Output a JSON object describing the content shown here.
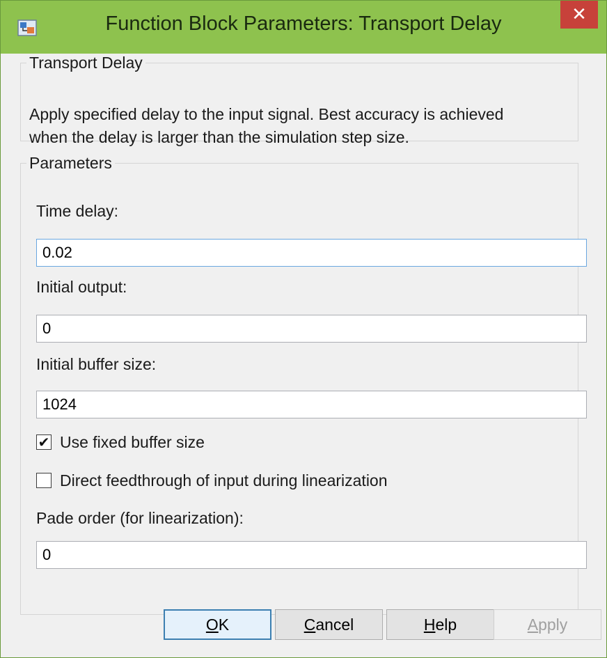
{
  "window": {
    "title": "Function Block Parameters: Transport Delay",
    "close_glyph": "✕"
  },
  "description_group": {
    "legend": "Transport Delay",
    "text_line1": "Apply specified delay to the input signal.  Best accuracy is achieved",
    "text_line2": "when the delay is larger than the simulation step size."
  },
  "parameters_group": {
    "legend": "Parameters",
    "time_delay": {
      "label": "Time delay:",
      "value": "0.02"
    },
    "initial_output": {
      "label": "Initial output:",
      "value": "0"
    },
    "initial_buffer_size": {
      "label": "Initial buffer size:",
      "value": "1024"
    },
    "use_fixed_buffer": {
      "label": "Use fixed buffer size",
      "checked": true,
      "mark": "✔"
    },
    "direct_feedthrough": {
      "label": "Direct feedthrough of input during linearization",
      "checked": false,
      "mark": ""
    },
    "pade_order": {
      "label": "Pade order (for linearization):",
      "value": "0"
    }
  },
  "buttons": {
    "ok": {
      "mnemonic": "O",
      "rest": "K"
    },
    "cancel": {
      "mnemonic": "C",
      "rest": "ancel"
    },
    "help": {
      "mnemonic": "H",
      "rest": "elp"
    },
    "apply": {
      "mnemonic": "A",
      "rest": "pply"
    }
  },
  "icons": {
    "app": "simulink-block-icon",
    "close": "close-icon",
    "check": "checkmark-icon"
  },
  "colors": {
    "titlebar": "#8ec24e",
    "close_button": "#c7413a",
    "focus_border": "#6aa7e0",
    "default_button_border": "#3c7fb1"
  }
}
